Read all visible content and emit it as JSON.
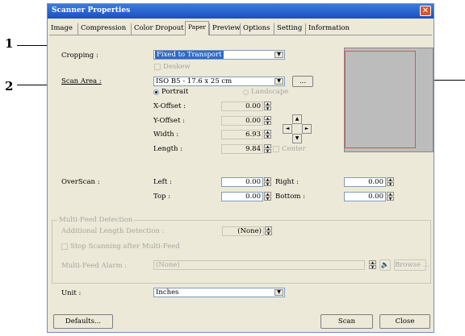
{
  "callouts": {
    "one": "1",
    "two": "2"
  },
  "window": {
    "title": "Scanner Properties",
    "close_glyph": "✕"
  },
  "tabs": [
    {
      "label": "Image"
    },
    {
      "label": "Compression"
    },
    {
      "label": "Color Dropout"
    },
    {
      "label": "Paper"
    },
    {
      "label": "Preview"
    },
    {
      "label": "Options"
    },
    {
      "label": "Setting"
    },
    {
      "label": "Information"
    }
  ],
  "paper": {
    "cropping_label": "Cropping :",
    "cropping_value": "Fixed to Transport",
    "deskew_label": "Deskew",
    "scan_area_label": "Scan Area :",
    "scan_area_value": "ISO B5 - 17.6 x 25 cm",
    "browse_small": "...",
    "portrait_label": "Portrait",
    "landscape_label": "Landscape",
    "x_offset_label": "X-Offset :",
    "x_offset_value": "0.00",
    "y_offset_label": "Y-Offset :",
    "y_offset_value": "0.00",
    "width_label": "Width :",
    "width_value": "6.93",
    "length_label": "Length :",
    "length_value": "9.84",
    "center_label": "Center",
    "overscan_label": "OverScan :",
    "left_label": "Left :",
    "left_value": "0.00",
    "top_label": "Top :",
    "top_value": "0.00",
    "right_label": "Right :",
    "right_value": "0.00",
    "bottom_label": "Bottom :",
    "bottom_value": "0.00"
  },
  "multifeed": {
    "group_title": "Multi-Feed Detection",
    "length_label": "Additional Length Detection :",
    "length_value": "(None)",
    "stop_label": "Stop Scanning after Multi-Feed",
    "alarm_label": "Multi-Feed Alarm :",
    "alarm_value": "(None)",
    "browse_label": "Browse ..."
  },
  "unit": {
    "label": "Unit :",
    "value": "Inches"
  },
  "buttons": {
    "defaults": "Defaults...",
    "scan": "Scan",
    "close": "Close"
  },
  "icons": {
    "arrow_down": "▼",
    "arrow_up": "▲",
    "arrow_left": "◄",
    "arrow_right": "►",
    "speaker": "🔈"
  },
  "colors": {
    "titlebar": "#1a4fc0",
    "selection": "#316ac5",
    "dialog_bg": "#ece9d8",
    "preview_bg": "#bcbcbc",
    "crop_frame": "#e05050",
    "close_button": "#d9542c"
  }
}
